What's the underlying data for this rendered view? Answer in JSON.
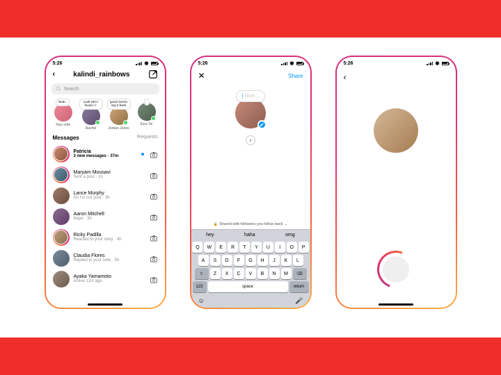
{
  "status_time": "5:26",
  "phone1": {
    "username": "kalindi_rainbows",
    "search_placeholder": "Search",
    "notes": [
      {
        "text": "Note...",
        "name": "Your note",
        "cls": "av-a",
        "dot": false
      },
      {
        "text": "Look who I found 👀",
        "name": "Rachel",
        "cls": "av-b",
        "dot": true
      },
      {
        "text": "good mornin say it back",
        "name": "Jordan Jones",
        "cls": "av-c",
        "dot": true
      },
      {
        "text": "",
        "name": "Ezra Tel",
        "cls": "av-d",
        "dot": true
      }
    ],
    "messages_heading": "Messages",
    "requests_label": "Requests",
    "threads": [
      {
        "name": "Patricia",
        "sub": "3 new messages · 37m",
        "unread": true,
        "cls": "av-e",
        "ring": true
      },
      {
        "name": "Maryam Mousavi",
        "sub": "Sent a post · 1h",
        "unread": false,
        "cls": "av-f",
        "ring": true
      },
      {
        "name": "Lance Murphy",
        "sub": "Ah I'm not sure · 3h",
        "unread": false,
        "cls": "av-g",
        "ring": false
      },
      {
        "name": "Aaron Mitchell",
        "sub": "Nope · 3h",
        "unread": false,
        "cls": "av-h",
        "ring": false
      },
      {
        "name": "Ricky Padilla",
        "sub": "Reacted to your story · 4h",
        "unread": false,
        "cls": "av-i",
        "ring": true
      },
      {
        "name": "Claudia Flores",
        "sub": "Replied to your note · 5h",
        "unread": false,
        "cls": "av-j",
        "ring": false
      },
      {
        "name": "Ayaka Yamamoto",
        "sub": "Active 12m ago",
        "unread": false,
        "cls": "av-k",
        "ring": false
      }
    ]
  },
  "phone2": {
    "share_label": "Share",
    "placeholder": "Note...",
    "shared_with": "Shared with followers you follow back",
    "suggestions": [
      "hey",
      "haha",
      "omg"
    ],
    "kbd": {
      "r1": [
        "Q",
        "W",
        "E",
        "R",
        "T",
        "Y",
        "U",
        "I",
        "O",
        "P"
      ],
      "r2": [
        "A",
        "S",
        "D",
        "F",
        "G",
        "H",
        "J",
        "K",
        "L"
      ],
      "r3_shift": "⇧",
      "r3": [
        "Z",
        "X",
        "C",
        "V",
        "B",
        "N",
        "M"
      ],
      "r3_del": "⌫",
      "num": "123",
      "space": "space",
      "ret": "return"
    }
  }
}
